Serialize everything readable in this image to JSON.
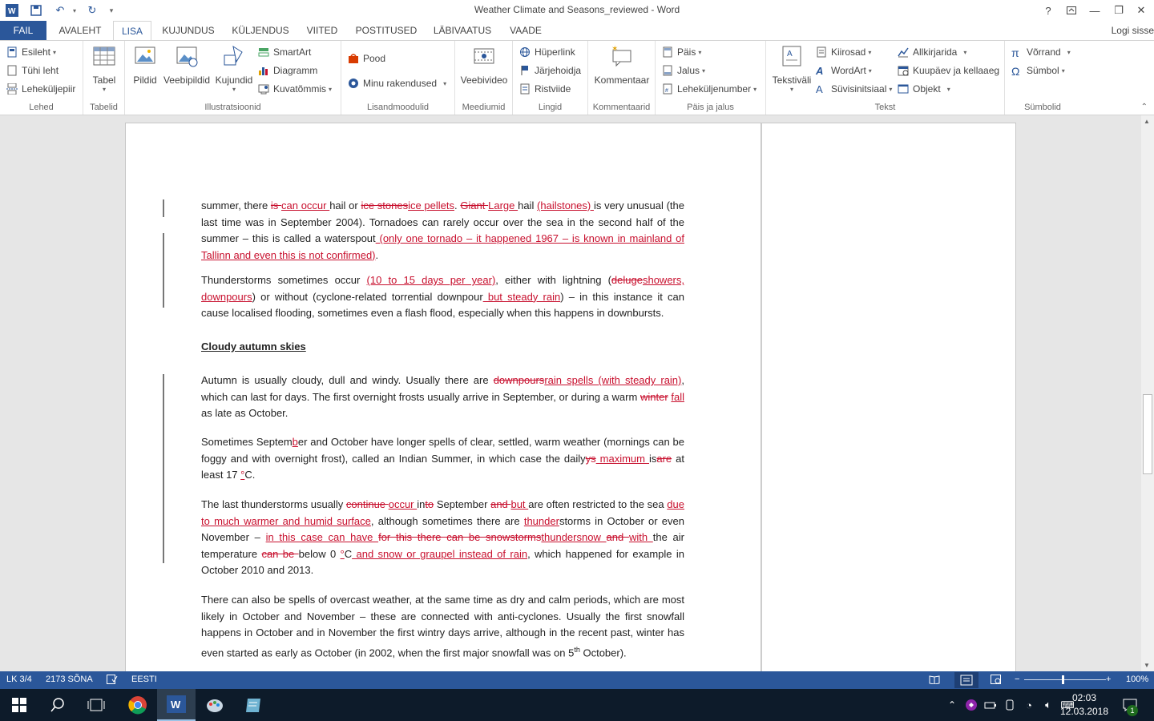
{
  "window": {
    "title": "Weather Climate and Seasons_reviewed - Word"
  },
  "tabs": [
    {
      "label": "FAIL"
    },
    {
      "label": "AVALEHT"
    },
    {
      "label": "LISA"
    },
    {
      "label": "KUJUNDUS"
    },
    {
      "label": "KÜLJENDUS"
    },
    {
      "label": "VIITED"
    },
    {
      "label": "POSTITUSED"
    },
    {
      "label": "LÄBIVAATUS"
    },
    {
      "label": "VAADE"
    }
  ],
  "login": "Logi sisse",
  "ribbon": {
    "lehed": {
      "label": "Lehed",
      "esileht": "Esileht",
      "tyhi": "Tühi leht",
      "lehekyljepiir": "Leheküljepiir"
    },
    "tabelid": {
      "label": "Tabelid",
      "tabel": "Tabel"
    },
    "illustr": {
      "label": "Illustratsioonid",
      "pildid": "Pildid",
      "veebipildid": "Veebipildid",
      "kujundid": "Kujundid",
      "smartart": "SmartArt",
      "diagramm": "Diagramm",
      "kuvatommis": "Kuvatõmmis"
    },
    "lisand": {
      "label": "Lisandmoodulid",
      "pood": "Pood",
      "minu": "Minu rakendused"
    },
    "meedium": {
      "label": "Meediumid",
      "veebivideo": "Veebivideo"
    },
    "lingid": {
      "label": "Lingid",
      "hyperlink": "Hüperlink",
      "jarjehoidja": "Järjehoidja",
      "ristviide": "Ristviide"
    },
    "komm": {
      "label": "Kommentaarid",
      "kommentaar": "Kommentaar"
    },
    "pais": {
      "label": "Päis ja jalus",
      "pais": "Päis",
      "jalus": "Jalus",
      "lkn": "Leheküljenumber"
    },
    "tekst": {
      "label": "Tekst",
      "tekstivali": "Tekstiväli",
      "kiirosad": "Kiirosad",
      "wordart": "WordArt",
      "suvis": "Süvisinitsiaal",
      "allkiri": "Allkirjarida",
      "kuupaev": "Kuupäev ja kellaaeg",
      "objekt": "Objekt"
    },
    "symbol": {
      "label": "Sümbolid",
      "vorrand": "Võrrand",
      "symbol": "Sümbol"
    }
  },
  "doc": {
    "p1": [
      [
        "n",
        "summer, there "
      ],
      [
        "d",
        "is "
      ],
      [
        "i",
        "can occur "
      ],
      [
        "n",
        "hail or "
      ],
      [
        "d",
        "ice stones"
      ],
      [
        "i",
        "ice pellets"
      ],
      [
        "n",
        ". "
      ],
      [
        "d",
        "Giant "
      ],
      [
        "i",
        "Large "
      ],
      [
        "n",
        "hail "
      ],
      [
        "i",
        "(hailstones) "
      ],
      [
        "n",
        "is very unusual (the last time was in September 2004). Tornadoes can rarely occur over the sea in the second half of the summer – this is called a waterspout"
      ],
      [
        "i",
        " (only one tornado – it happened 1967 – is known in mainland of Tallinn and even this is not confirmed)"
      ],
      [
        "n",
        "."
      ]
    ],
    "p2": [
      [
        "n",
        "Thunderstorms sometimes occur "
      ],
      [
        "i",
        "(10 to 15 days per year)"
      ],
      [
        "n",
        ", either with lightning ("
      ],
      [
        "d",
        "deluge"
      ],
      [
        "i",
        "showers, downpours"
      ],
      [
        "n",
        ") or without (cyclone-related torrential downpour"
      ],
      [
        "i",
        " but steady rain"
      ],
      [
        "n",
        ") – in this instance it can cause localised flooding, sometimes even a flash flood, especially when this happens in downbursts."
      ]
    ],
    "heading": "Cloudy autumn skies",
    "p3": [
      [
        "n",
        "Autumn is usually cloudy, dull and windy. Usually there are "
      ],
      [
        "d",
        "downpours"
      ],
      [
        "i",
        "rain spells (with steady rain)"
      ],
      [
        "n",
        ", which can last for days. The first overnight frosts usually arrive in September, or during a warm "
      ],
      [
        "d",
        "winter"
      ],
      [
        "n",
        " "
      ],
      [
        "i",
        "fall "
      ],
      [
        "n",
        "as late as October."
      ]
    ],
    "p4": [
      [
        "n",
        "Sometimes Septem"
      ],
      [
        "i",
        "b"
      ],
      [
        "n",
        "er and October have longer spells of clear, settled, warm weather (mornings can be foggy and with overnight frost), called an Indian Summer, in which case the daily"
      ],
      [
        "d",
        "ys"
      ],
      [
        "i",
        " maximum "
      ],
      [
        "n",
        "is"
      ],
      [
        "d",
        "are"
      ],
      [
        "n",
        " at least 17 "
      ],
      [
        "i",
        "°"
      ],
      [
        "n",
        "C."
      ]
    ],
    "p5": [
      [
        "n",
        "The last thunderstorms usually "
      ],
      [
        "d",
        "continue "
      ],
      [
        "i",
        "occur "
      ],
      [
        "n",
        "in"
      ],
      [
        "d",
        "to"
      ],
      [
        "n",
        " September "
      ],
      [
        "d",
        "and "
      ],
      [
        "i",
        "but "
      ],
      [
        "n",
        "are often restricted to the sea "
      ],
      [
        "i",
        "due to much warmer and humid surface"
      ],
      [
        "n",
        ", although sometimes there are "
      ],
      [
        "i",
        "thunder"
      ],
      [
        "n",
        "storms in October or even November – "
      ],
      [
        "i",
        "in this case can have "
      ],
      [
        "d",
        "for this there can be snowstorms"
      ],
      [
        "i",
        "thundersnow "
      ],
      [
        "d",
        "and "
      ],
      [
        "i",
        "with "
      ],
      [
        "n",
        "the air temperature "
      ],
      [
        "d",
        "can be "
      ],
      [
        "n",
        "below 0 "
      ],
      [
        "i",
        "°"
      ],
      [
        "n",
        "C"
      ],
      [
        "i",
        " and snow or graupel instead of rain"
      ],
      [
        "n",
        ", which happened for example in October 2010 and 2013."
      ]
    ],
    "p6": [
      [
        "n",
        "There can also be spells of overcast weather, at the same time as dry and calm periods, which are most likely in October and November – these are connected with anti-cyclones. Usually the first snowfall happens in October and in November the first wintry days arrive, although in the recent past, winter has even started as early as October (in 2002, when the first major snowfall was on 5"
      ],
      [
        "s",
        "th"
      ],
      [
        "n",
        " October)."
      ]
    ]
  },
  "status": {
    "page": "LK 3/4",
    "words": "2173 SÕNA",
    "lang": "EESTI",
    "zoom": "100%"
  },
  "taskbar": {
    "time": "02:03",
    "date": "12.03.2018",
    "notif": "1"
  },
  "colors": {
    "accent": "#2b579a",
    "track": "#c8102e"
  }
}
